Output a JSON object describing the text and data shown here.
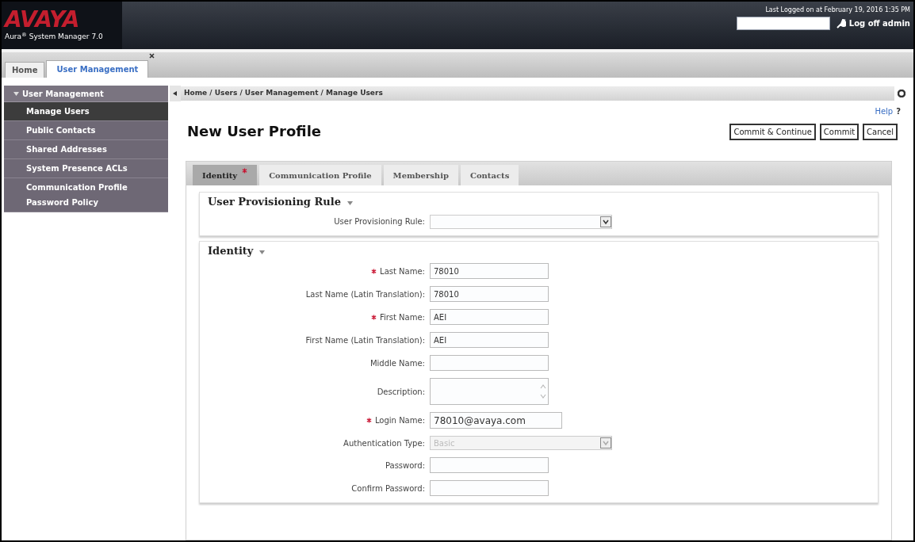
{
  "header": {
    "logo": "AVAYA",
    "product": "Aura$^{®}$ System Manager 7.0",
    "last_logged": "Last Logged on at February 19, 2016 1:35 PM",
    "logoff": "Log off admin"
  },
  "app_tabs": [
    {
      "label": "Home",
      "selected": false,
      "closable": false
    },
    {
      "label": "User Management",
      "selected": true,
      "closable": true
    }
  ],
  "sidebar": {
    "title": "User Management",
    "expanded": true,
    "items": [
      {
        "label": "Manage Users",
        "selected": true
      },
      {
        "label": "Public Contacts",
        "selected": false
      },
      {
        "label": "Shared Addresses",
        "selected": false
      },
      {
        "label": "System Presence ACLs",
        "selected": false
      },
      {
        "label": "Communication Profile Password Policy",
        "selected": false
      }
    ]
  },
  "breadcrumb": "Home / Users / User Management / Manage Users",
  "help": "Help",
  "help_mark": "?",
  "page_title": "New User Profile",
  "buttons": [
    "Commit & Continue",
    "Commit",
    "Cancel"
  ],
  "tabs": [
    {
      "label": "Identity",
      "selected": true,
      "required": true
    },
    {
      "label": "Communication Profile",
      "selected": false,
      "required": false
    },
    {
      "label": "Membership",
      "selected": false,
      "required": false
    },
    {
      "label": "Contacts",
      "selected": false,
      "required": false
    }
  ],
  "sections": [
    {
      "title": "User Provisioning Rule",
      "fields": [
        {
          "kind": "select",
          "label": "User Provisioning Rule:",
          "required": false,
          "disabled": false
        }
      ]
    },
    {
      "title": "Identity",
      "fields": [
        {
          "kind": "text",
          "label": "Last Name:",
          "value": "78010",
          "required": true,
          "disabled": false
        },
        {
          "kind": "text",
          "label": "Last Name (Latin Translation):",
          "value": "78010",
          "required": false,
          "disabled": false
        },
        {
          "kind": "text",
          "label": "First Name:",
          "value": "AEI",
          "required": true,
          "disabled": false
        },
        {
          "kind": "text",
          "label": "First Name (Latin Translation):",
          "value": "AEI",
          "required": false,
          "disabled": false
        },
        {
          "kind": "text",
          "label": "Middle Name:",
          "required": false,
          "disabled": false
        },
        {
          "kind": "textarea",
          "label": "Description:",
          "required": false,
          "disabled": false
        },
        {
          "kind": "login",
          "label": "Login Name:",
          "value": "78010@avaya.com",
          "required": true,
          "disabled": false
        },
        {
          "kind": "select",
          "label": "Authentication Type:",
          "value": "Basic",
          "required": false,
          "disabled": true
        },
        {
          "kind": "text",
          "label": "Password:",
          "required": false,
          "disabled": false
        },
        {
          "kind": "text",
          "label": "Confirm Password:",
          "required": false,
          "disabled": false
        }
      ]
    }
  ]
}
